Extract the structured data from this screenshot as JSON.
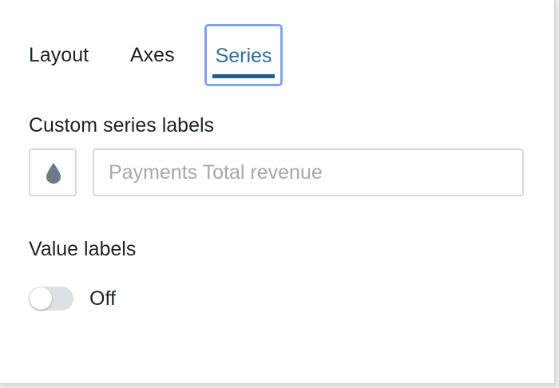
{
  "tabs": {
    "layout": "Layout",
    "axes": "Axes",
    "series": "Series",
    "active": "Series"
  },
  "custom_series_labels": {
    "title": "Custom series labels",
    "color_icon": "droplet-icon",
    "color_value": "#6b7b88",
    "input_value": "",
    "input_placeholder": "Payments Total revenue"
  },
  "value_labels": {
    "title": "Value labels",
    "toggle_state": "Off"
  },
  "colors": {
    "active_tab_text": "#2e6d9f",
    "active_tab_underline": "#1f5e8f",
    "focus_ring": "#7da3f5"
  }
}
